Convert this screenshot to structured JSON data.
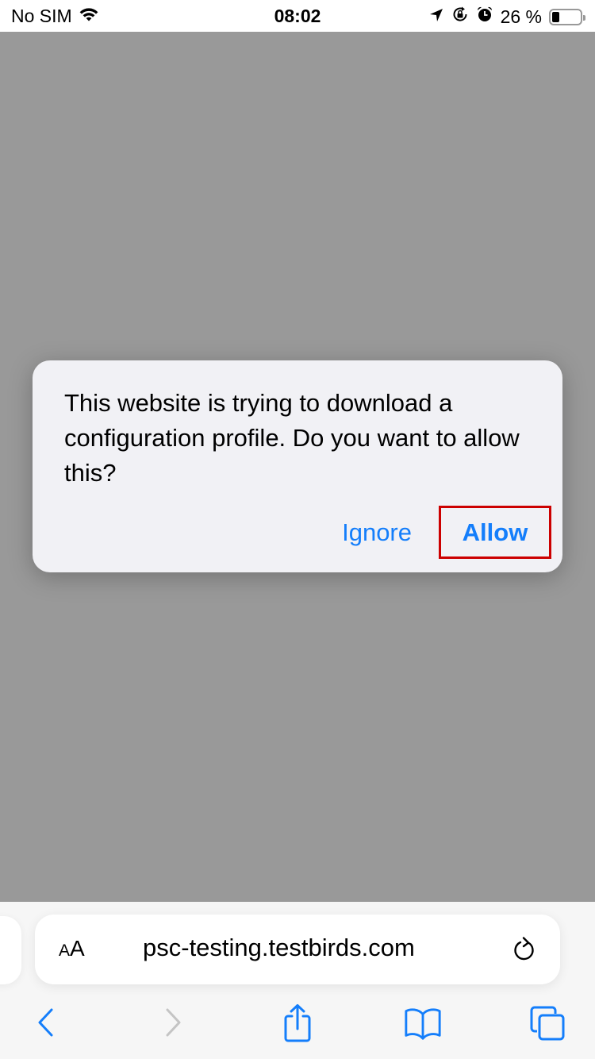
{
  "status_bar": {
    "carrier": "No SIM",
    "time": "08:02",
    "battery_percent_label": "26 %",
    "battery_level": 0.26,
    "icons": [
      "wifi-icon",
      "location-arrow-icon",
      "orientation-lock-icon",
      "alarm-icon",
      "battery-icon"
    ]
  },
  "dialog": {
    "message": "This website is trying to download a configuration profile. Do you want to allow this?",
    "buttons": {
      "ignore": "Ignore",
      "allow": "Allow"
    },
    "highlight_color": "#cc0000",
    "accent_color": "#147efb"
  },
  "address_bar": {
    "text_size_label_small": "A",
    "text_size_label_large": "A",
    "url": "psc-testing.testbirds.com"
  },
  "toolbar": {
    "items": [
      {
        "name": "back",
        "icon": "chevron-left-icon",
        "enabled": true
      },
      {
        "name": "forward",
        "icon": "chevron-right-icon",
        "enabled": false
      },
      {
        "name": "share",
        "icon": "share-icon",
        "enabled": true
      },
      {
        "name": "bookmarks",
        "icon": "book-icon",
        "enabled": true
      },
      {
        "name": "tabs",
        "icon": "tabs-icon",
        "enabled": true
      }
    ]
  }
}
